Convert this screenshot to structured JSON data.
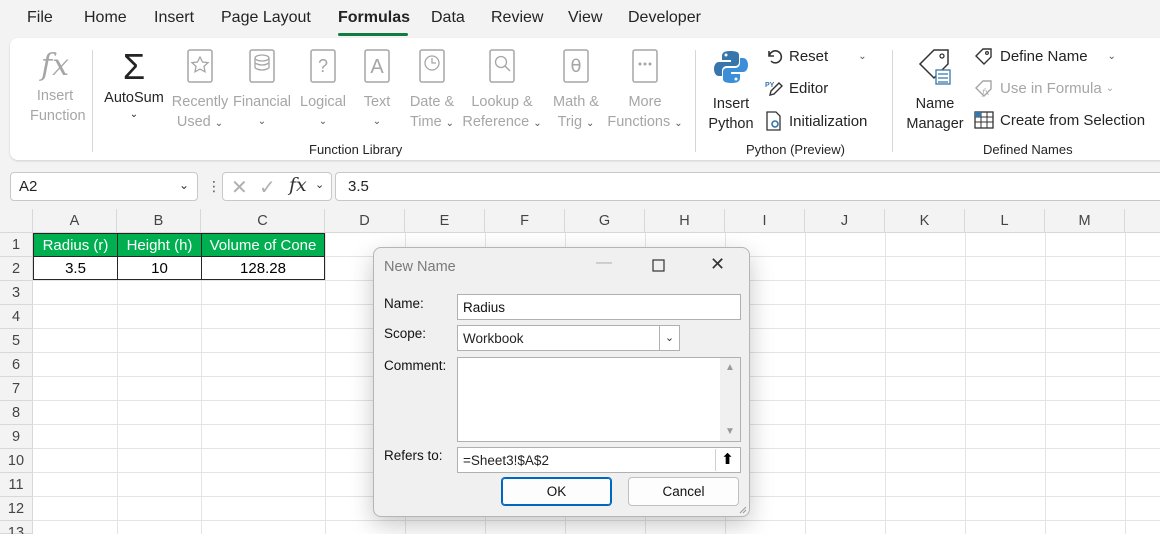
{
  "menu": {
    "tabs": [
      {
        "label": "File"
      },
      {
        "label": "Home"
      },
      {
        "label": "Insert"
      },
      {
        "label": "Page Layout"
      },
      {
        "label": "Formulas"
      },
      {
        "label": "Data"
      },
      {
        "label": "Review"
      },
      {
        "label": "View"
      },
      {
        "label": "Developer"
      }
    ],
    "active": "Formulas"
  },
  "ribbon": {
    "function_library": {
      "group_label": "Function Library",
      "insert_function": {
        "line1": "Insert",
        "line2": "Function"
      },
      "autosum": {
        "line1": "AutoSum"
      },
      "recently_used": {
        "line1": "Recently",
        "line2": "Used"
      },
      "financial": {
        "line1": "Financial"
      },
      "logical": {
        "line1": "Logical"
      },
      "text": {
        "line1": "Text"
      },
      "date_time": {
        "line1": "Date &",
        "line2": "Time"
      },
      "lookup_reference": {
        "line1": "Lookup &",
        "line2": "Reference"
      },
      "math_trig": {
        "line1": "Math &",
        "line2": "Trig"
      },
      "more_functions": {
        "line1": "More",
        "line2": "Functions"
      }
    },
    "python": {
      "group_label": "Python (Preview)",
      "insert_python": {
        "line1": "Insert",
        "line2": "Python"
      },
      "reset": "Reset",
      "editor": "Editor",
      "initialization": "Initialization"
    },
    "defined_names": {
      "group_label": "Defined Names",
      "name_manager": {
        "line1": "Name",
        "line2": "Manager"
      },
      "define_name": "Define Name",
      "use_in_formula": "Use in Formula",
      "create_from_selection": "Create from Selection"
    }
  },
  "formula_bar": {
    "name_box": "A2",
    "formula": "3.5",
    "fx": "fx"
  },
  "sheet": {
    "columns": [
      "A",
      "B",
      "C",
      "D",
      "E",
      "F",
      "G",
      "H",
      "I",
      "J",
      "K",
      "L",
      "M"
    ],
    "rows": [
      "1",
      "2",
      "3",
      "4",
      "5",
      "6",
      "7",
      "8",
      "9",
      "10",
      "11",
      "12",
      "13"
    ],
    "headers": [
      "Radius (r)",
      "Height (h)",
      "Volume of Cone"
    ],
    "values": [
      "3.5",
      "10",
      "128.28"
    ],
    "header_fill": "#00b050"
  },
  "dialog": {
    "title": "New Name",
    "name_label": "Name:",
    "name_value": "Radius",
    "scope_label": "Scope:",
    "scope_value": "Workbook",
    "comment_label": "Comment:",
    "comment_value": "",
    "refers_label": "Refers to:",
    "refers_value": "=Sheet3!$A$2",
    "ok": "OK",
    "cancel": "Cancel"
  },
  "colors": {
    "accent": "#107c41",
    "ok_border": "#0067c0"
  }
}
